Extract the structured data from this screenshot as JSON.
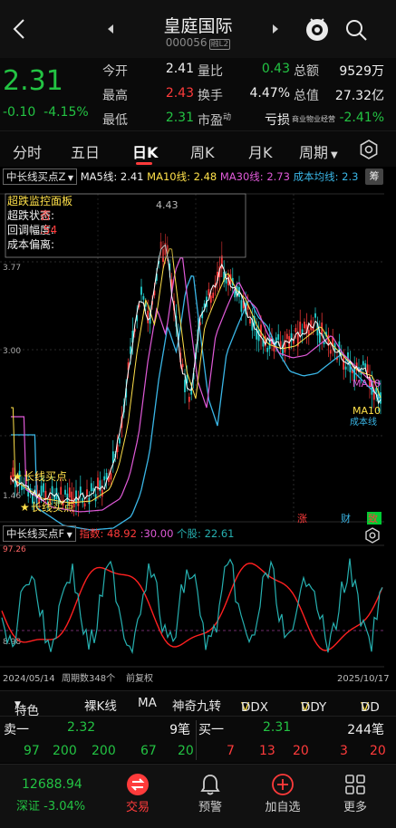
{
  "header": {
    "title": "皇庭国际",
    "code": "000056",
    "badge": "融L2"
  },
  "quote": {
    "price": "2.31",
    "change": "-0.10",
    "change_pct": "-4.15%",
    "open_label": "今开",
    "open": "2.41",
    "high_label": "最高",
    "high": "2.43",
    "low_label": "最低",
    "low": "2.31",
    "volume_ratio_label": "量比",
    "volume_ratio": "0.43",
    "turnover_label": "换手",
    "turnover": "4.47%",
    "pe_label": "市盈",
    "pe_suffix": "动",
    "pe": "亏损",
    "amount_label": "总额",
    "amount": "9529万",
    "market_cap_label": "总值",
    "market_cap": "27.32亿",
    "sector": "商业物业经营",
    "sector_change": "-2.41%"
  },
  "tabs": [
    "分时",
    "五日",
    "日K",
    "周K",
    "月K",
    "周期"
  ],
  "active_tab": "日K",
  "indicator": {
    "selector": "中长线买点Z",
    "ma5": "MA5线: 2.41",
    "ma10": "MA10线: 2.48",
    "ma30": "MA30线: 2.73",
    "cost": "成本均线: 2.3",
    "fu_btn": "筹"
  },
  "panel": {
    "title": "超跌监控面板",
    "status_label": "超跌状态:",
    "status_value": "否",
    "pullback_label": "回调幅度:",
    "pullback_value": ".54",
    "deviation_label": "成本偏离:",
    "deviation_value": ""
  },
  "chart_labels": {
    "peak": "4.43",
    "y_top": "3.77",
    "y_mid": "3.00",
    "y_low": "1.46",
    "buy1": "长线买点",
    "buy2": "长线买点",
    "ma10_tag": "MA10",
    "ma5_tag": "MA5",
    "cost_tag": "成本线",
    "mark_zhang": "涨",
    "mark_cai": "财",
    "mark_zhi": "致"
  },
  "sub_indicator": {
    "selector": "中长线买点F",
    "index": "指数: 48.92",
    "threshold": ":30.00",
    "stock": "个股: 22.61",
    "y_top": "97.26",
    "y_bottom": "8.98"
  },
  "axis": {
    "start_date": "2024/05/14",
    "period_count": "周期数348个",
    "adjust": "前复权",
    "end_date": "2025/10/17"
  },
  "toolbar": [
    "特色",
    "裸K线",
    "MA",
    "神奇九转",
    "DDX",
    "DDY",
    "DD"
  ],
  "order_book": {
    "sell_label": "卖一",
    "sell_price": "2.32",
    "sell_count": "9笔",
    "buy_label": "买一",
    "buy_price": "2.31",
    "buy_count": "244笔",
    "sell_queue": [
      "97",
      "200",
      "200",
      "67",
      "20"
    ],
    "buy_queue": [
      "7",
      "13",
      "20",
      "3",
      "20"
    ]
  },
  "index_ticker": {
    "value": "12688.94",
    "label": "深证",
    "change": "-3.04%"
  },
  "nav": [
    "交易",
    "预警",
    "加自选",
    "更多"
  ],
  "colors": {
    "up": "#ff3b3b",
    "down": "#23c343",
    "ma5": "#ffffff",
    "ma10": "#ffe14a",
    "ma30": "#e05ad8",
    "cost": "#3ab6e6"
  }
}
